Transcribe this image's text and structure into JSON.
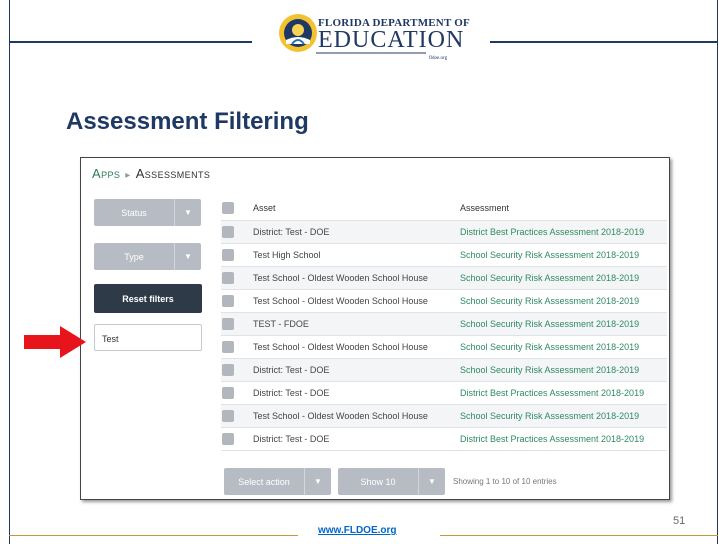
{
  "logo": {
    "line1": "FLORIDA DEPARTMENT OF",
    "line2": "EDUCATION",
    "line3": "fldoe.org"
  },
  "slide_title": "Assessment Filtering",
  "app": {
    "breadcrumb": {
      "root": "Apps",
      "current": "Assessments"
    },
    "filters": {
      "status_label": "Status",
      "type_label": "Type",
      "reset_label": "Reset filters",
      "search_value": "Test"
    },
    "table": {
      "columns": [
        "Asset",
        "Assessment"
      ],
      "rows": [
        {
          "asset": "District: Test - DOE",
          "assessment": "District Best Practices Assessment 2018-2019"
        },
        {
          "asset": "Test High School",
          "assessment": "School Security Risk Assessment 2018-2019"
        },
        {
          "asset": "Test School - Oldest Wooden School House",
          "assessment": "School Security Risk Assessment 2018-2019"
        },
        {
          "asset": "Test School - Oldest Wooden School House",
          "assessment": "School Security Risk Assessment 2018-2019"
        },
        {
          "asset": "TEST - FDOE",
          "assessment": "School Security Risk Assessment 2018-2019"
        },
        {
          "asset": "Test School - Oldest Wooden School House",
          "assessment": "School Security Risk Assessment 2018-2019"
        },
        {
          "asset": "District: Test - DOE",
          "assessment": "School Security Risk Assessment 2018-2019"
        },
        {
          "asset": "District: Test - DOE",
          "assessment": "District Best Practices Assessment 2018-2019"
        },
        {
          "asset": "Test School - Oldest Wooden School House",
          "assessment": "School Security Risk Assessment 2018-2019"
        },
        {
          "asset": "District: Test - DOE",
          "assessment": "District Best Practices Assessment 2018-2019"
        }
      ]
    },
    "bottom": {
      "select_action_label": "Select action",
      "show_label": "Show 10",
      "info_text": "Showing 1 to 10 of 10 entries"
    }
  },
  "footer": {
    "url": "www.FLDOE.org",
    "page_number": "51"
  },
  "colors": {
    "navy": "#1f3864",
    "link_green": "#2e8a63",
    "arrow_red": "#e8141b",
    "gold": "#c09a3a"
  }
}
